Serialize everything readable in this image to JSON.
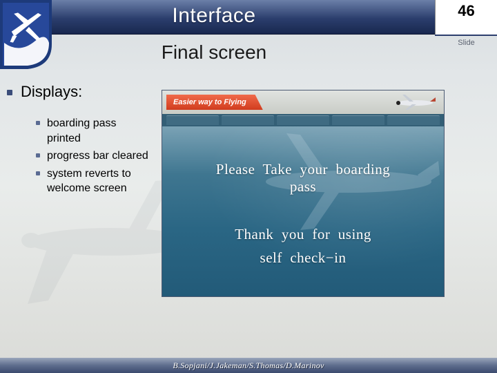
{
  "header": {
    "title": "Interface",
    "page_number": "46",
    "page_label": "Slide"
  },
  "subtitle": "Final screen",
  "body": {
    "heading": "Displays:",
    "items": [
      "boarding pass printed",
      "progress bar cleared",
      "system reverts to welcome screen"
    ]
  },
  "mock": {
    "banner": "Easier way to Flying",
    "line1": "Please  Take  your  boarding\npass",
    "line2": "Thank  you  for  using\nself  check−in"
  },
  "footer": "B.Sopjani/J.Jakeman/S.Thomas/D.Marinov"
}
